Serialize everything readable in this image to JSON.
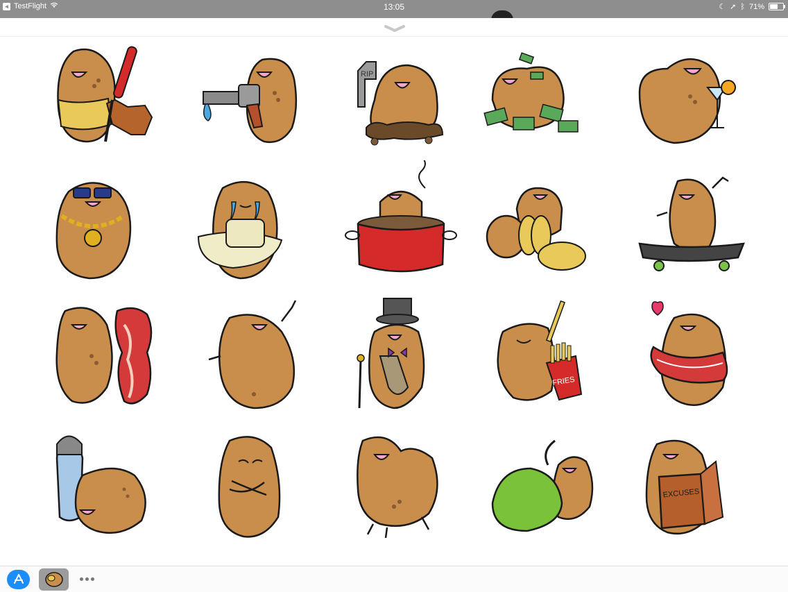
{
  "status_bar": {
    "back_app": "TestFlight",
    "time": "13:05",
    "battery": "71%",
    "battery_level": 0.71
  },
  "colors": {
    "potato": "#c98d4c",
    "outline": "#1a1a1a",
    "mouth": "#f2a8c8",
    "accent_blue": "#1c8ef9"
  },
  "stickers": [
    {
      "name": "potato-with-peeler"
    },
    {
      "name": "potato-with-gun"
    },
    {
      "name": "potato-rip-grave"
    },
    {
      "name": "potato-with-money"
    },
    {
      "name": "potato-with-cocktail"
    },
    {
      "name": "potato-with-sunglasses-chain"
    },
    {
      "name": "potato-crying-pillow"
    },
    {
      "name": "potato-in-pot"
    },
    {
      "name": "potato-sliced"
    },
    {
      "name": "potato-on-skateboard"
    },
    {
      "name": "potato-with-bacon"
    },
    {
      "name": "potato-waving"
    },
    {
      "name": "potato-top-hat"
    },
    {
      "name": "potato-with-fries"
    },
    {
      "name": "potato-with-heart-scarf"
    },
    {
      "name": "potato-with-salt-shaker"
    },
    {
      "name": "potato-arms-crossed"
    },
    {
      "name": "potato-happy-blob"
    },
    {
      "name": "potato-with-green-blanket"
    },
    {
      "name": "potato-with-excuses-book"
    }
  ],
  "sticker_text": {
    "rip": "RIP",
    "fries": "FRIES",
    "excuses": "EXCUSES"
  },
  "bottom_bar": {
    "appstore_icon": "app-store-icon",
    "selected_app_icon": "potato-app-icon",
    "more_icon": "more-dots-icon"
  }
}
